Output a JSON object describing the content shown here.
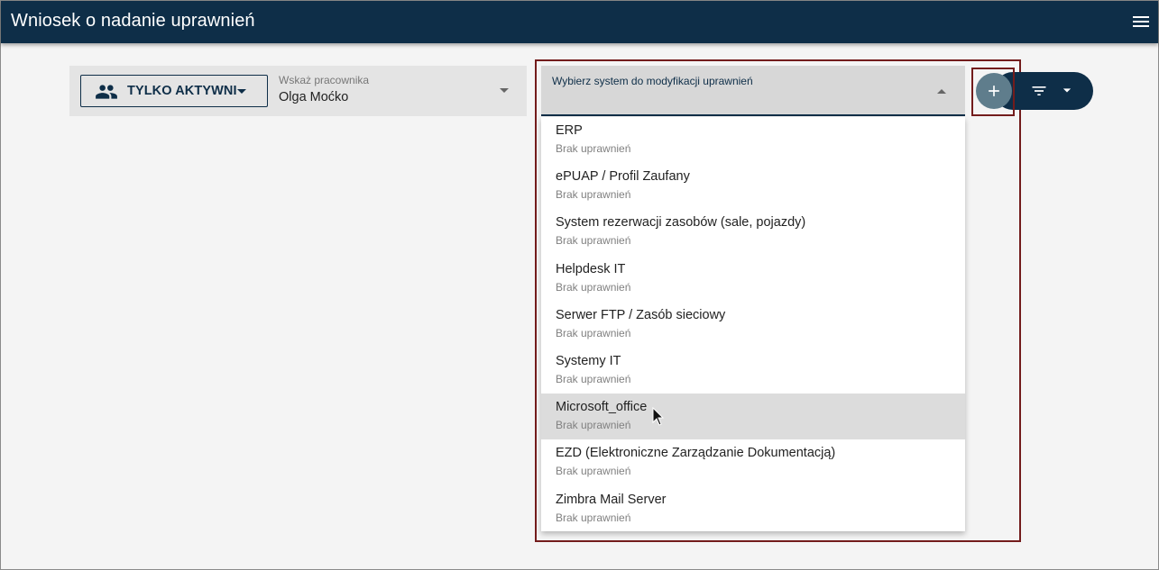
{
  "app": {
    "title": "Wniosek o nadanie uprawnień"
  },
  "filters": {
    "active_label": "TYLKO AKTYWNI",
    "employee_label": "Wskaż pracownika",
    "employee_value": "Olga Moćko"
  },
  "system_select": {
    "label": "Wybierz system do modyfikacji uprawnień",
    "options": [
      {
        "name": "ERP",
        "status": "Brak uprawnień"
      },
      {
        "name": "ePUAP / Profil Zaufany",
        "status": "Brak uprawnień"
      },
      {
        "name": "System rezerwacji zasobów (sale, pojazdy)",
        "status": "Brak uprawnień"
      },
      {
        "name": "Helpdesk IT",
        "status": "Brak uprawnień"
      },
      {
        "name": "Serwer FTP / Zasób sieciowy",
        "status": "Brak uprawnień"
      },
      {
        "name": "Systemy IT",
        "status": "Brak uprawnień"
      },
      {
        "name": "Microsoft_office",
        "status": "Brak uprawnień"
      },
      {
        "name": "EZD (Elektroniczne Zarządzanie Dokumentacją)",
        "status": "Brak uprawnień"
      },
      {
        "name": "Zimbra Mail Server",
        "status": "Brak uprawnień"
      }
    ],
    "hovered_option": "Microsoft_office"
  },
  "colors": {
    "primary": "#0e2e48",
    "add_button": "#5f7d8c",
    "highlight": "#731c1c"
  },
  "icons": {
    "menu": "menu-icon",
    "people": "people-icon",
    "add": "plus-icon",
    "filter": "filter-icon",
    "caret": "caret-down-icon"
  }
}
